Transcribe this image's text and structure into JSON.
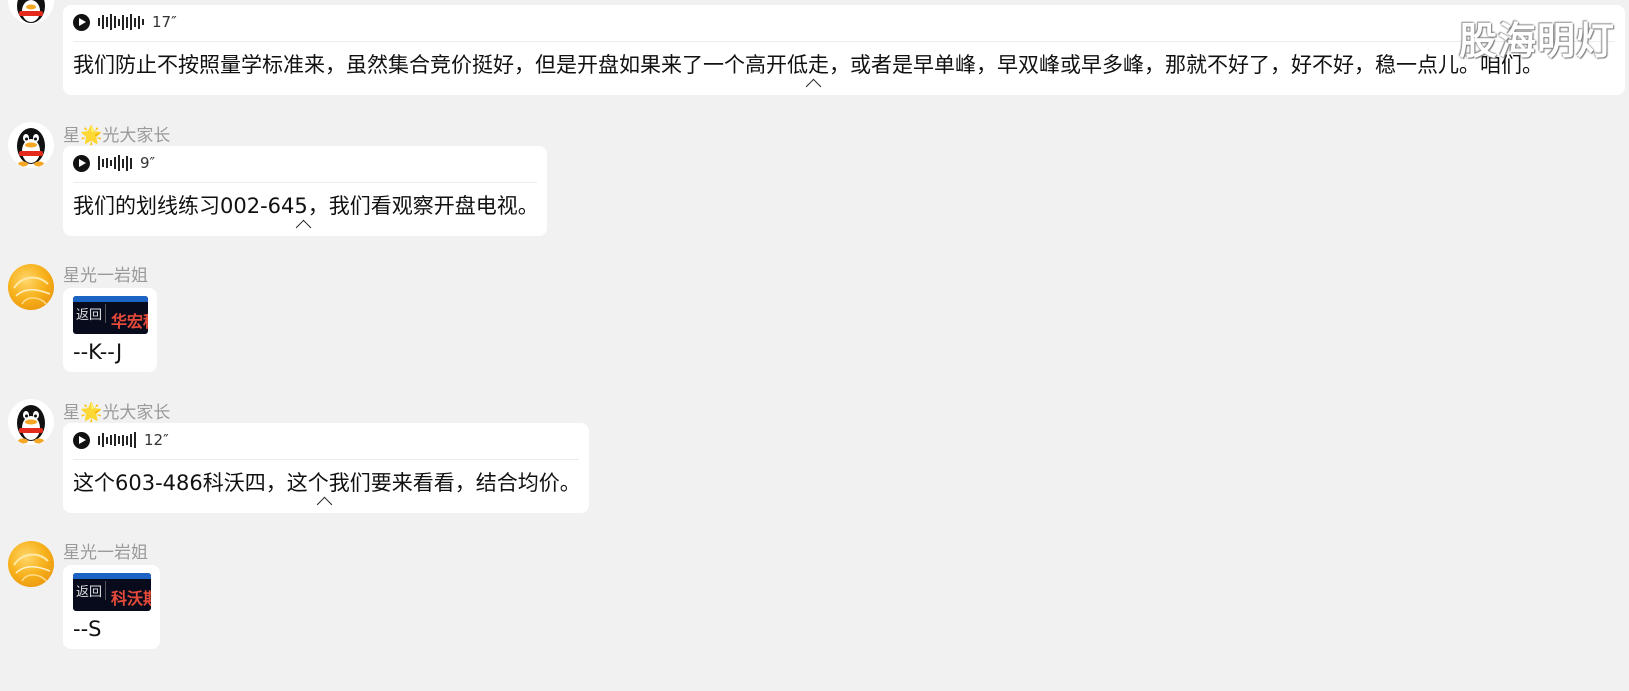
{
  "watermark": "股海明灯",
  "messages": [
    {
      "sender": "",
      "type": "voice",
      "duration": "17″",
      "transcript": "我们防止不按照量学标准来，虽然集合竞价挺好，但是开盘如果来了一个高开低走，或者是早单峰，早双峰或早多峰，那就不好了，好不好，稳一点儿。咱们。"
    },
    {
      "sender_prefix": "星",
      "sender_star": "🌟",
      "sender_suffix": "光大家长",
      "type": "voice",
      "duration": "9″",
      "transcript": "我们的划线练习002-645，我们看观察开盘电视。"
    },
    {
      "sender": "星光一岩姐",
      "type": "image",
      "thumb_back": "返回",
      "thumb_stock": "华宏科",
      "caption": "--K--J"
    },
    {
      "sender_prefix": "星",
      "sender_star": "🌟",
      "sender_suffix": "光大家长",
      "type": "voice",
      "duration": "12″",
      "transcript": "这个603-486科沃四，这个我们要来看看，结合均价。"
    },
    {
      "sender": "星光一岩姐",
      "type": "image",
      "thumb_back": "返回",
      "thumb_stock": "科沃斯",
      "caption": "--S"
    }
  ]
}
